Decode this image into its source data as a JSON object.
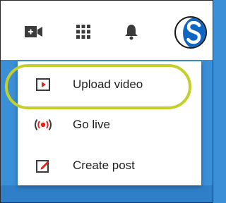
{
  "header": {
    "icons": [
      "video-camera-plus-icon",
      "apps-grid-icon",
      "notifications-bell-icon"
    ],
    "avatar_icon": "channel-avatar-icon"
  },
  "menu": {
    "items": [
      {
        "label": "Upload video",
        "icon": "upload-video-icon",
        "highlighted": true
      },
      {
        "label": "Go live",
        "icon": "go-live-icon",
        "highlighted": false
      },
      {
        "label": "Create post",
        "icon": "create-post-icon",
        "highlighted": false
      }
    ]
  },
  "colors": {
    "accent_red": "#e62117",
    "highlight_ring": "#c5cf2a",
    "avatar_blue": "#0f66c2",
    "background_blue": "#3a8fd6"
  }
}
